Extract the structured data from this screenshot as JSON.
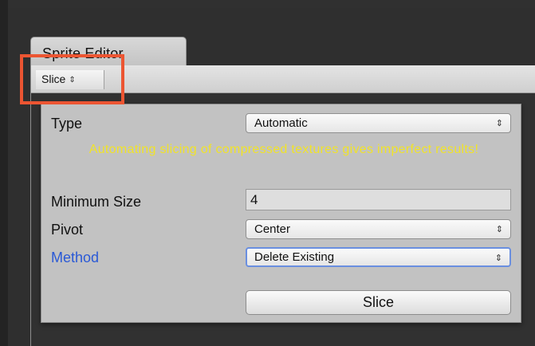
{
  "window": {
    "tab_title": "Sprite Editor"
  },
  "toolbar": {
    "slice_menu_label": "Slice",
    "arrows_glyph": "⇕"
  },
  "popup": {
    "type_label": "Type",
    "type_value": "Automatic",
    "warning_text": "Automating slicing of compressed textures gives imperfect results!",
    "min_size_label": "Minimum Size",
    "min_size_value": "4",
    "pivot_label": "Pivot",
    "pivot_value": "Center",
    "method_label": "Method",
    "method_value": "Delete Existing",
    "slice_button_label": "Slice"
  },
  "colors": {
    "warning": "#f0e32a",
    "method_label": "#2a59d6",
    "highlight": "#ec5532"
  }
}
